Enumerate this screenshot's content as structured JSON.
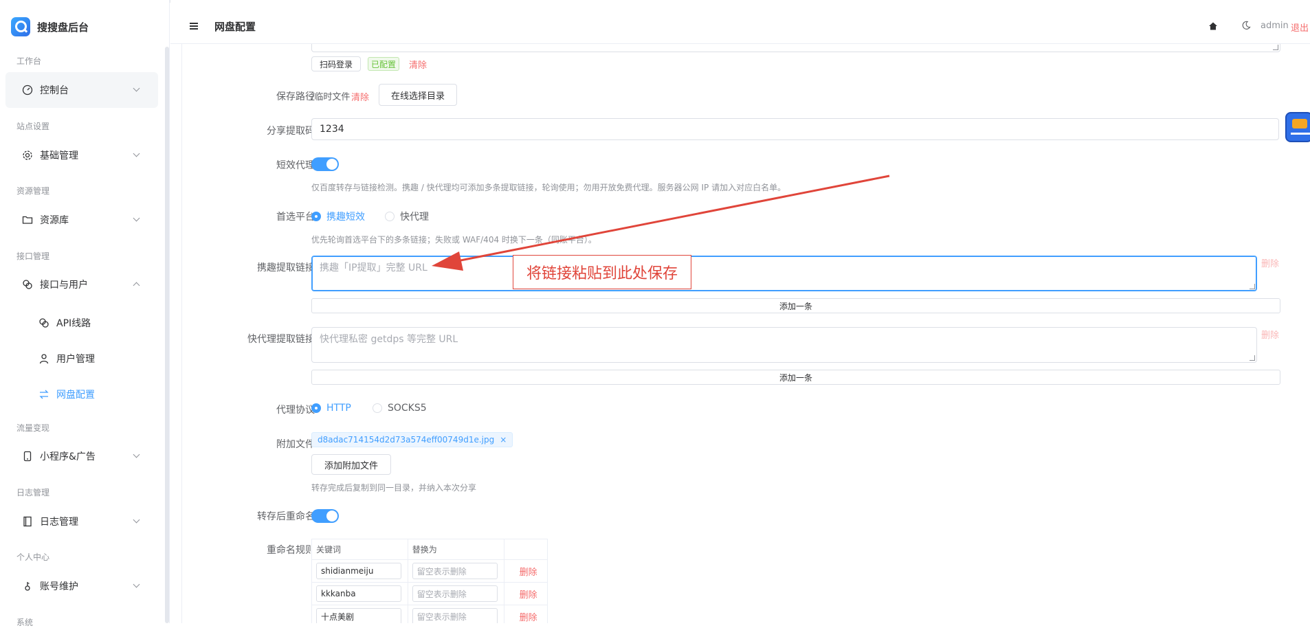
{
  "app": {
    "name": "搜搜盘后台"
  },
  "sidebar": {
    "groups": [
      {
        "title": "工作台",
        "item": "控制台"
      },
      {
        "title": "站点设置",
        "item": "基础管理"
      },
      {
        "title": "资源管理",
        "item": "资源库"
      },
      {
        "title": "接口管理",
        "item": "接口与用户"
      },
      {
        "title": "流量变现",
        "item": "小程序&广告"
      },
      {
        "title": "日志管理",
        "item": "日志管理"
      },
      {
        "title": "个人中心",
        "item": "账号维护"
      },
      {
        "title": "系统"
      }
    ],
    "sub_items": [
      "API线路",
      "用户管理",
      "网盘配置"
    ]
  },
  "header": {
    "title": "网盘配置",
    "user": "admin",
    "logout": "退出"
  },
  "form": {
    "qr_login": "扫码登录",
    "configured": "已配置",
    "clear": "清除",
    "save_path_label": "保存路径",
    "save_path_value": "/临时文件",
    "select_dir": "在线选择目录",
    "share_code_label": "分享提取码",
    "share_code_value": "1234",
    "proxy_label": "短效代理",
    "proxy_help": "仅百度转存与链接检测。携趣 / 快代理均可添加多条提取链接，轮询使用；勿用开放免费代理。服务器公网 IP 请加入对应白名单。",
    "platform_label": "首选平台",
    "platform_opt1": "携趣短效",
    "platform_opt2": "快代理",
    "platform_help": "优先轮询首选平台下的多条链接；失败或 WAF/404 时换下一条（同账平台）。",
    "xiequ_label": "携趣提取链接",
    "xiequ_placeholder": "携趣「IP提取」完整 URL",
    "delete": "删除",
    "add_one": "添加一条",
    "kdl_label": "快代理提取链接",
    "kdl_placeholder": "快代理私密 getdps 等完整 URL",
    "protocol_label": "代理协议",
    "protocol_opt1": "HTTP",
    "protocol_opt2": "SOCKS5",
    "attach_label": "附加文件",
    "attach_file": "d8adac714154d2d73a574eff00749d1e.jpg",
    "attach_btn": "添加附加文件",
    "attach_help": "转存完成后复制到同一目录，并纳入本次分享",
    "rename_label": "转存后重命名",
    "rules_label": "重命名规则",
    "rules_headers": [
      "关键词",
      "替换为"
    ],
    "rules": [
      {
        "keyword": "shidianmeiju",
        "replace_placeholder": "留空表示删除",
        "action": "删除"
      },
      {
        "keyword": "kkkanba",
        "replace_placeholder": "留空表示删除",
        "action": "删除"
      },
      {
        "keyword": "十点美剧",
        "replace_placeholder": "留空表示删除",
        "action": "删除"
      }
    ]
  },
  "annotation": {
    "text": "将链接粘贴到此处保存",
    "color": "#e0453a"
  },
  "colors": {
    "primary": "#409eff",
    "danger": "#f56c6c",
    "success": "#67c23a"
  }
}
